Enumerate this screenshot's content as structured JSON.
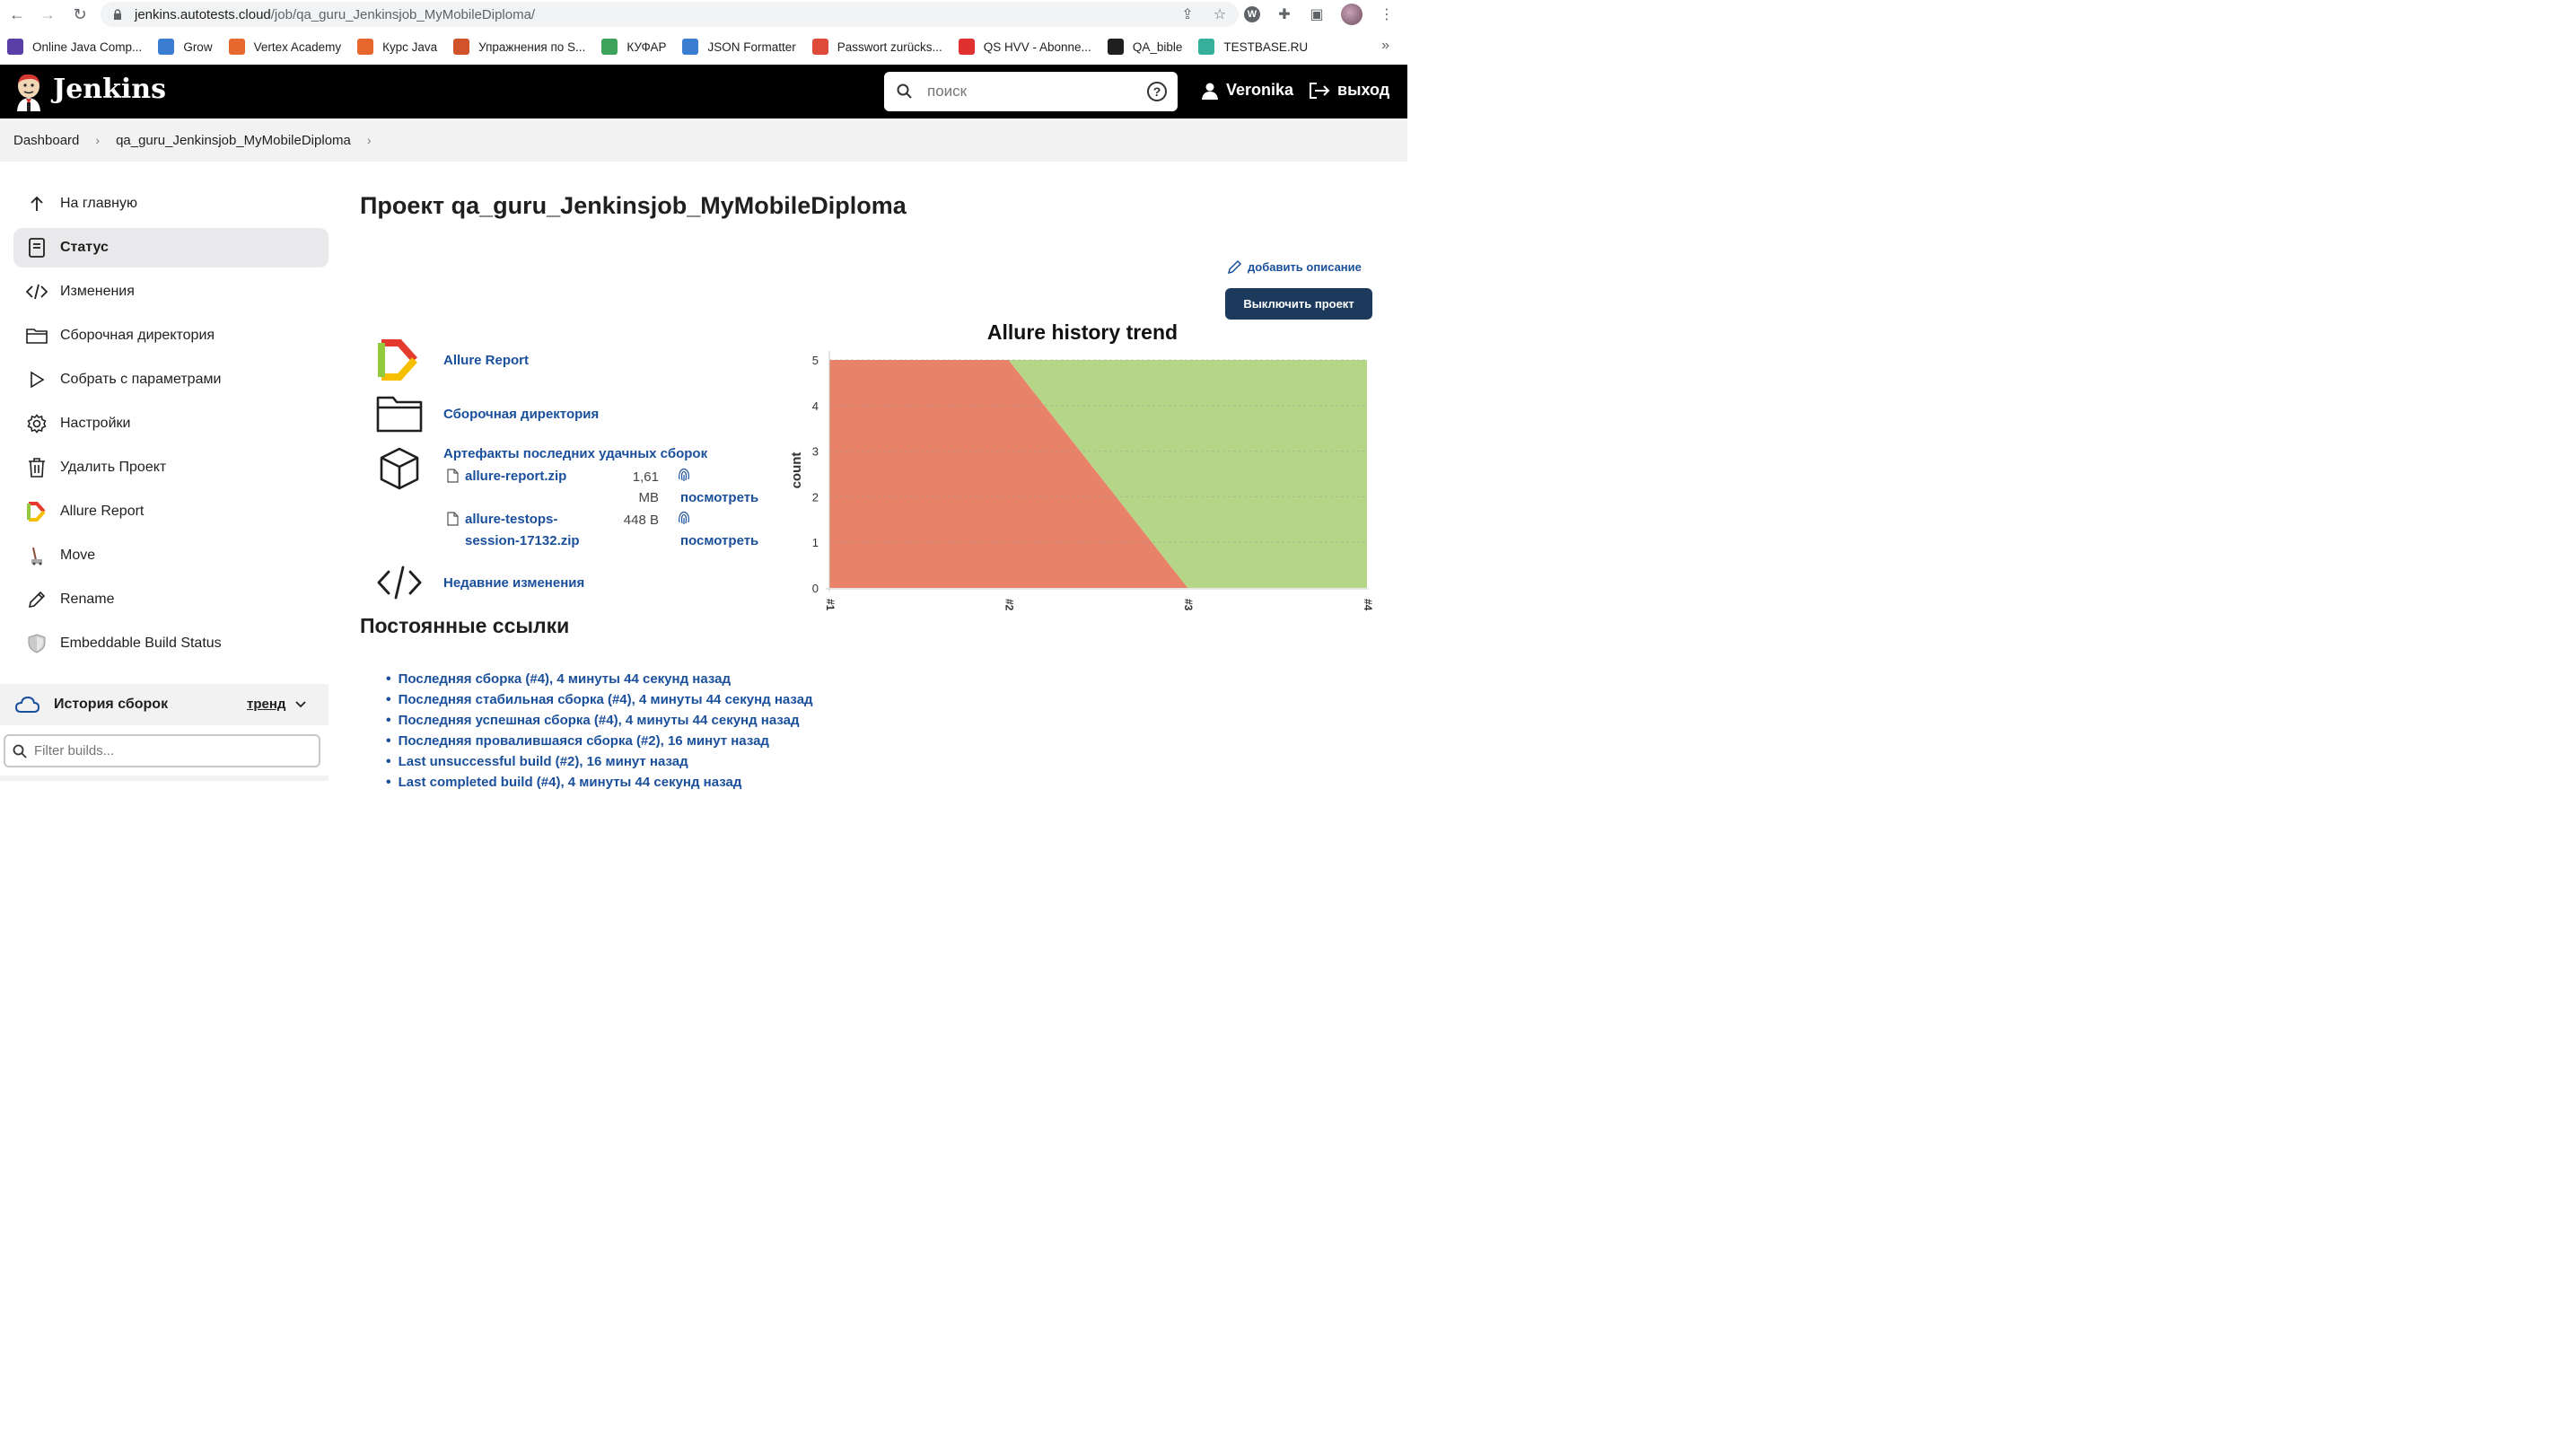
{
  "browser": {
    "url_host": "jenkins.autotests.cloud",
    "url_path": "/job/qa_guru_Jenkinsjob_MyMobileDiploma/",
    "bookmarks": [
      {
        "label": "Online Java Comp...",
        "color": "#5b3fa8"
      },
      {
        "label": "Grow",
        "color": "#3b7ed1"
      },
      {
        "label": "Vertex Academy",
        "color": "#e8672d"
      },
      {
        "label": "Курс Java",
        "color": "#e8672d"
      },
      {
        "label": "Упражнения по S...",
        "color": "#d0532a"
      },
      {
        "label": "КУФАР",
        "color": "#3da35a"
      },
      {
        "label": "JSON Formatter",
        "color": "#3b7ed1"
      },
      {
        "label": "Passwort zurücks...",
        "color": "#e04a3a"
      },
      {
        "label": "QS HVV - Abonne...",
        "color": "#e03030"
      },
      {
        "label": "QA_bible",
        "color": "#1f1f1f"
      },
      {
        "label": "TESTBASE.RU",
        "color": "#35b09a"
      }
    ],
    "bookmarks_more": "»"
  },
  "header": {
    "title": "Jenkins",
    "search_placeholder": "поиск",
    "help_symbol": "?",
    "user": "Veronika",
    "logout": "выход"
  },
  "breadcrumb": {
    "items": [
      "Dashboard",
      "qa_guru_Jenkinsjob_MyMobileDiploma"
    ]
  },
  "sidebar": {
    "items": [
      {
        "label": "На главную",
        "icon": "arrow-up-icon"
      },
      {
        "label": "Статус",
        "icon": "document-icon"
      },
      {
        "label": "Изменения",
        "icon": "code-icon"
      },
      {
        "label": "Сборочная директория",
        "icon": "folder-icon"
      },
      {
        "label": "Собрать с параметрами",
        "icon": "play-icon"
      },
      {
        "label": "Настройки",
        "icon": "gear-icon"
      },
      {
        "label": "Удалить Проект",
        "icon": "trash-icon"
      },
      {
        "label": "Allure Report",
        "icon": "allure-icon"
      },
      {
        "label": "Move",
        "icon": "move-icon"
      },
      {
        "label": "Rename",
        "icon": "pencil-icon"
      },
      {
        "label": "Embeddable Build Status",
        "icon": "shield-icon"
      }
    ],
    "history_label": "История сборок",
    "trend_label": "тренд",
    "filter_placeholder": "Filter builds..."
  },
  "main": {
    "title": "Проект qa_guru_Jenkinsjob_MyMobileDiploma",
    "add_description": "добавить описание",
    "disable_button": "Выключить проект",
    "allure_report": "Allure Report",
    "workspace": "Сборочная директория",
    "artifacts_title": "Артефакты последних удачных сборок",
    "artifacts": [
      {
        "name": "allure-report.zip",
        "size_1": "1,61",
        "size_2": "MB",
        "view": "посмотреть"
      },
      {
        "name_1": "allure-testops-",
        "name_2": "session-17132.zip",
        "size": "448 B",
        "view": "посмотреть"
      }
    ],
    "recent_changes": "Недавние изменения",
    "permalinks_title": "Постоянные ссылки",
    "permalinks": [
      "Последняя сборка (#4), 4 минуты 44 секунд назад",
      "Последняя стабильная сборка (#4), 4 минуты 44 секунд назад",
      "Последняя успешная сборка (#4), 4 минуты 44 секунд назад",
      "Последняя провалившаяся сборка (#2), 16 минут назад",
      "Last unsuccessful build (#2), 16 минут назад",
      "Last completed build (#4), 4 минуты 44 секунд назад"
    ]
  },
  "chart_data": {
    "type": "area",
    "title": "Allure history trend",
    "ylabel": "count",
    "xlabel": "",
    "categories": [
      "#1",
      "#2",
      "#3",
      "#4"
    ],
    "ylim": [
      0,
      5
    ],
    "yticks": [
      0,
      1,
      2,
      3,
      4,
      5
    ],
    "series": [
      {
        "values": [
          5,
          5,
          0,
          0
        ],
        "color": "#e8836a"
      },
      {
        "values": [
          0,
          0,
          5,
          5
        ],
        "color": "#b5d687"
      }
    ]
  }
}
